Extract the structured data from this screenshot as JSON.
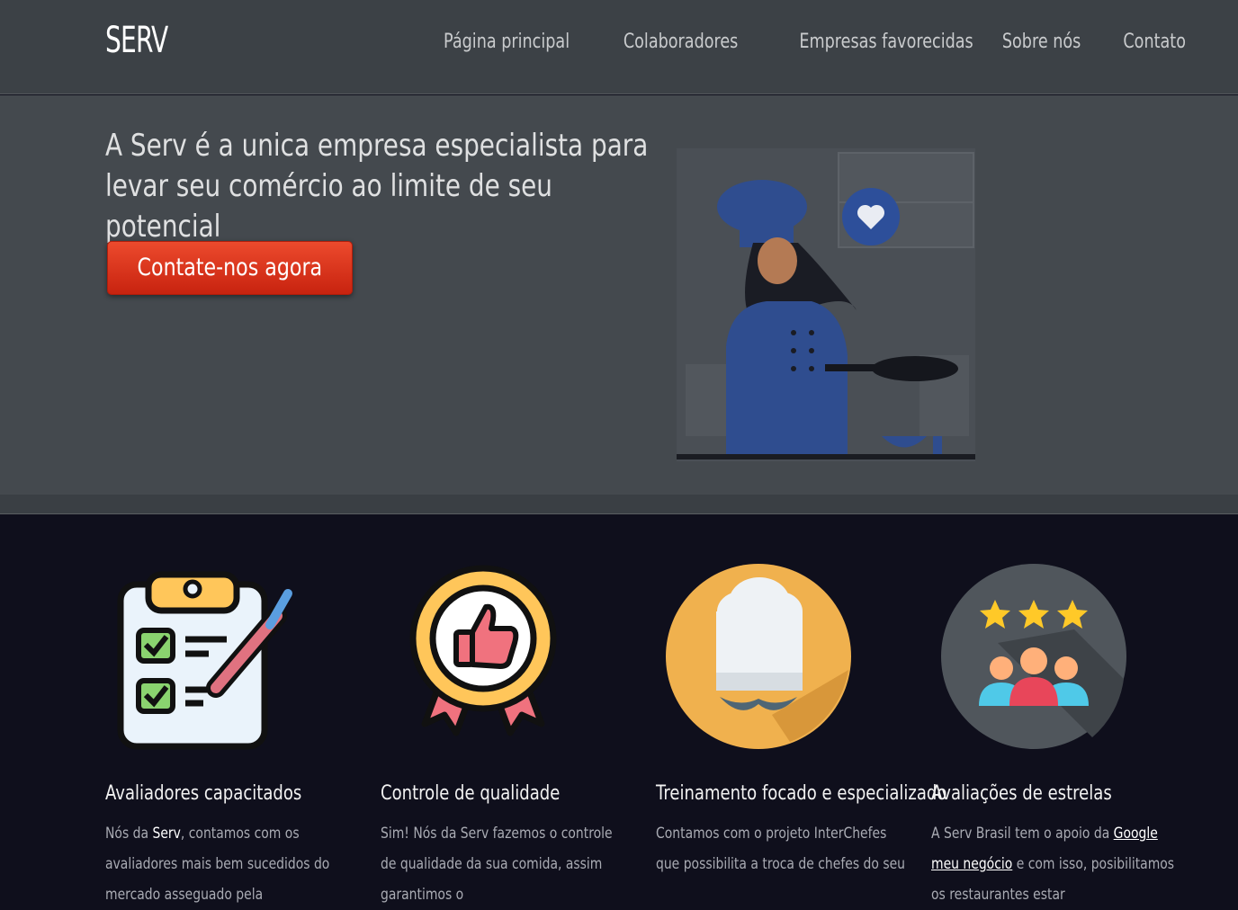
{
  "header": {
    "logo": "SERV",
    "nav": [
      "Página principal",
      "Colaboradores",
      "Empresas favorecidas",
      "Sobre nós",
      "Contato"
    ]
  },
  "hero": {
    "title_line1": "A Serv é a unica empresa especialista para",
    "title_line2": "levar seu comércio ao limite de seu potencial",
    "cta_label": "Contate-nos agora"
  },
  "features": [
    {
      "icon": "clipboard-checklist-icon",
      "title": "Avaliadores capacitados",
      "text_pre": "Nós da ",
      "text_strong": "Serv",
      "text_post": ", contamos com os avaliadores mais bem sucedidos do mercado asseguado pela"
    },
    {
      "icon": "thumbs-up-badge-icon",
      "title": "Controle de qualidade",
      "text": "Sim! Nós da Serv fazemos o controle de qualidade da sua comida, assim garantimos o"
    },
    {
      "icon": "chef-hat-icon",
      "title": "Treinamento focado e especializado",
      "text": "Contamos com o projeto InterChefes que possibilita a troca de chefes do seu"
    },
    {
      "icon": "star-rating-people-icon",
      "title": "Avaliações de estrelas",
      "text_pre": "A Serv Brasil tem o apoio da ",
      "text_link": "Google meu negócio",
      "text_post": " e com isso, posibilitamos os restaurantes estar"
    }
  ],
  "colors": {
    "header_bg": "#3c4146",
    "hero_bg": "#44494e",
    "cta_red": "#dc3519",
    "page_bg": "#0f0f1c"
  }
}
